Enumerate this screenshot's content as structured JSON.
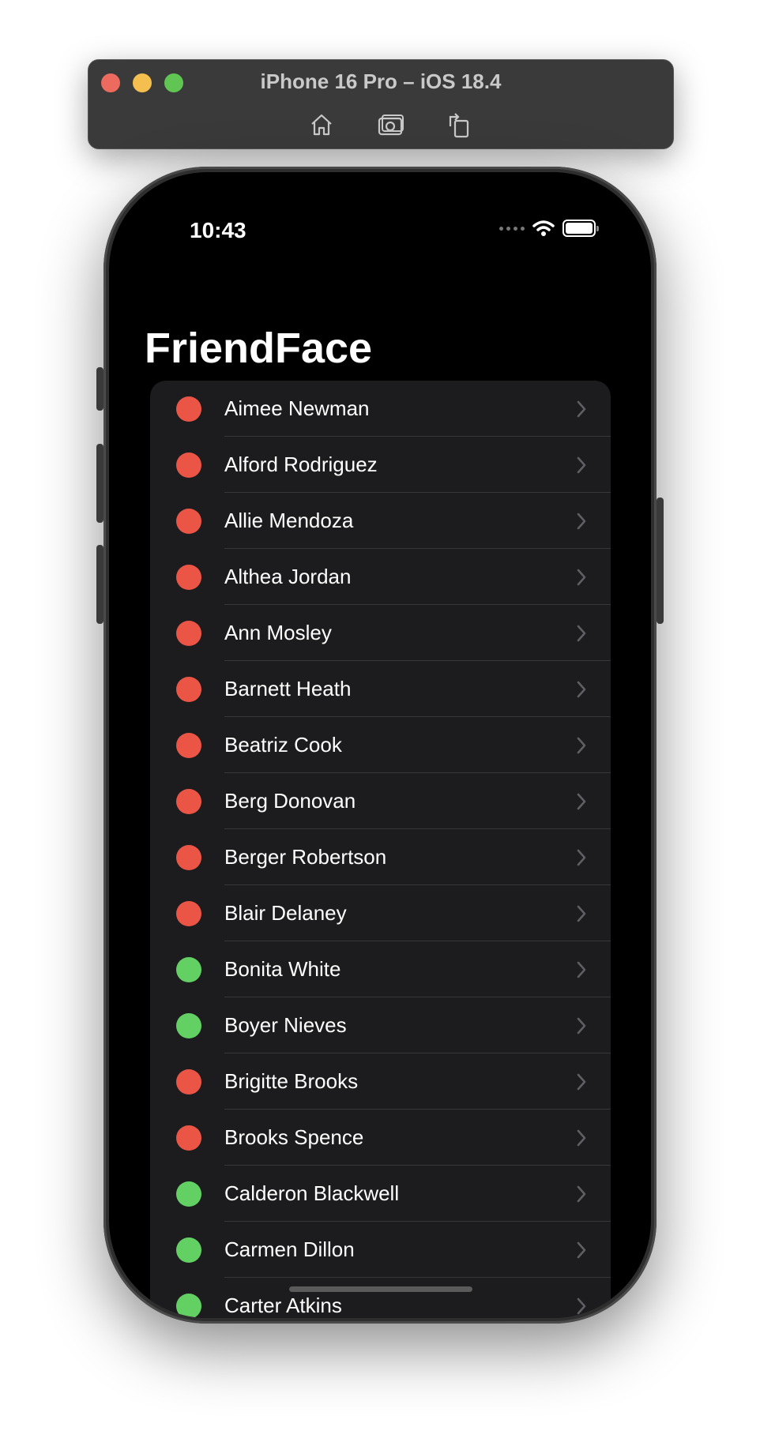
{
  "simulator": {
    "title": "iPhone 16 Pro – iOS 18.4",
    "buttons": [
      "home-icon",
      "screenshot-icon",
      "rotate-icon"
    ]
  },
  "status_bar": {
    "time": "10:43",
    "icons": [
      "cellular-icon",
      "wifi-icon",
      "battery-icon"
    ]
  },
  "app": {
    "title": "FriendFace"
  },
  "colors": {
    "inactive": "#eb5545",
    "active": "#63d064",
    "background": "#000000",
    "list_bg": "#1c1c1e"
  },
  "friends": [
    {
      "name": "Aimee Newman",
      "active": false
    },
    {
      "name": "Alford Rodriguez",
      "active": false
    },
    {
      "name": "Allie Mendoza",
      "active": false
    },
    {
      "name": "Althea Jordan",
      "active": false
    },
    {
      "name": "Ann Mosley",
      "active": false
    },
    {
      "name": "Barnett Heath",
      "active": false
    },
    {
      "name": "Beatriz Cook",
      "active": false
    },
    {
      "name": "Berg Donovan",
      "active": false
    },
    {
      "name": "Berger Robertson",
      "active": false
    },
    {
      "name": "Blair Delaney",
      "active": false
    },
    {
      "name": "Bonita White",
      "active": true
    },
    {
      "name": "Boyer Nieves",
      "active": true
    },
    {
      "name": "Brigitte Brooks",
      "active": false
    },
    {
      "name": "Brooks Spence",
      "active": false
    },
    {
      "name": "Calderon Blackwell",
      "active": true
    },
    {
      "name": "Carmen Dillon",
      "active": true
    },
    {
      "name": "Carter Atkins",
      "active": true
    }
  ]
}
